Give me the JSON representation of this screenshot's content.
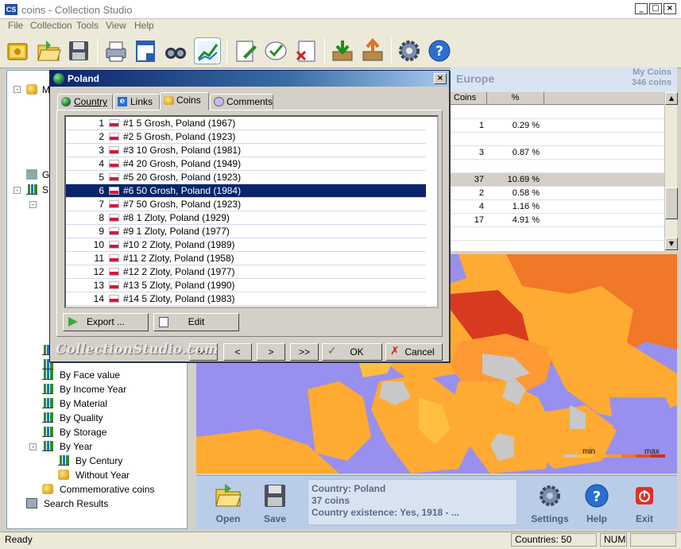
{
  "window": {
    "title": "coins - Collection Studio",
    "icon_text": "CS"
  },
  "menu": [
    "File",
    "Collection",
    "Tools",
    "View",
    "Help"
  ],
  "toolbar_icons": [
    "book-icon",
    "open-folder-icon",
    "save-disk-icon",
    "print-icon",
    "preview-icon",
    "binoculars-icon",
    "chart-icon",
    "edit-note-icon",
    "check-note-icon",
    "delete-note-icon",
    "import-icon",
    "export-icon",
    "settings-icon",
    "help-icon"
  ],
  "tree": {
    "partial": [
      "M",
      "G",
      "S"
    ],
    "items": [
      "By Face value",
      "By Income Year",
      "By Material",
      "By Quality",
      "By Storage",
      "By Year",
      "By Century",
      "Without Year",
      "Commemorative coins",
      "Search Results"
    ]
  },
  "right": {
    "header": "Europe",
    "my_coins": "My Coins",
    "coin_count": "346 coins",
    "columns": [
      "Coins",
      "%"
    ],
    "rows": [
      {
        "coins": "",
        "pct": ""
      },
      {
        "coins": "1",
        "pct": "0.29 %"
      },
      {
        "coins": "",
        "pct": ""
      },
      {
        "coins": "3",
        "pct": "0.87 %"
      },
      {
        "coins": "",
        "pct": ""
      },
      {
        "coins": "37",
        "pct": "10.69 %"
      },
      {
        "coins": "2",
        "pct": "0.58 %"
      },
      {
        "coins": "4",
        "pct": "1.16 %"
      },
      {
        "coins": "17",
        "pct": "4.91 %"
      },
      {
        "coins": "",
        "pct": ""
      }
    ]
  },
  "legend": {
    "min": "min",
    "max": "max",
    "colors": [
      "#c8c8c8",
      "#ffbf40",
      "#ffaa33",
      "#ff9933",
      "#f07828",
      "#e05020",
      "#d03020"
    ]
  },
  "bottom": {
    "open": "Open",
    "save": "Save",
    "settings": "Settings",
    "help": "Help",
    "exit": "Exit",
    "info": {
      "country": "Country: Poland",
      "coins": "37 coins",
      "existence": "Country existence: Yes, 1918 - ..."
    }
  },
  "status": {
    "ready": "Ready",
    "countries": "Countries: 50",
    "num": "NUM"
  },
  "dialog": {
    "title": "Poland",
    "tabs": [
      "Country",
      "Links",
      "Coins",
      "Comments"
    ],
    "coins": [
      {
        "n": "1",
        "text": "#1 5 Grosh, Poland (1967)"
      },
      {
        "n": "2",
        "text": "#2 5 Grosh, Poland (1923)"
      },
      {
        "n": "3",
        "text": "#3 10 Grosh, Poland (1981)"
      },
      {
        "n": "4",
        "text": "#4 20 Grosh, Poland (1949)"
      },
      {
        "n": "5",
        "text": "#5 20 Grosh, Poland (1923)"
      },
      {
        "n": "6",
        "text": "#6 50 Grosh, Poland (1984)"
      },
      {
        "n": "7",
        "text": "#7 50 Grosh, Poland (1923)"
      },
      {
        "n": "8",
        "text": "#8 1 Zloty, Poland (1929)"
      },
      {
        "n": "9",
        "text": "#9 1 Zloty, Poland (1977)"
      },
      {
        "n": "10",
        "text": "#10 2 Zloty, Poland (1989)"
      },
      {
        "n": "11",
        "text": "#11 2 Zloty, Poland (1958)"
      },
      {
        "n": "12",
        "text": "#12 2 Zloty, Poland (1977)"
      },
      {
        "n": "13",
        "text": "#13 5 Zloty, Poland (1990)"
      },
      {
        "n": "14",
        "text": "#14 5 Zloty, Poland (1983)"
      }
    ],
    "selected_index": 5,
    "export": "Export ...",
    "edit": "Edit",
    "nav": [
      "<<",
      "<",
      ">",
      ">>"
    ],
    "ok": "OK",
    "cancel": "Cancel",
    "watermark": "CollectionStudio.com"
  }
}
